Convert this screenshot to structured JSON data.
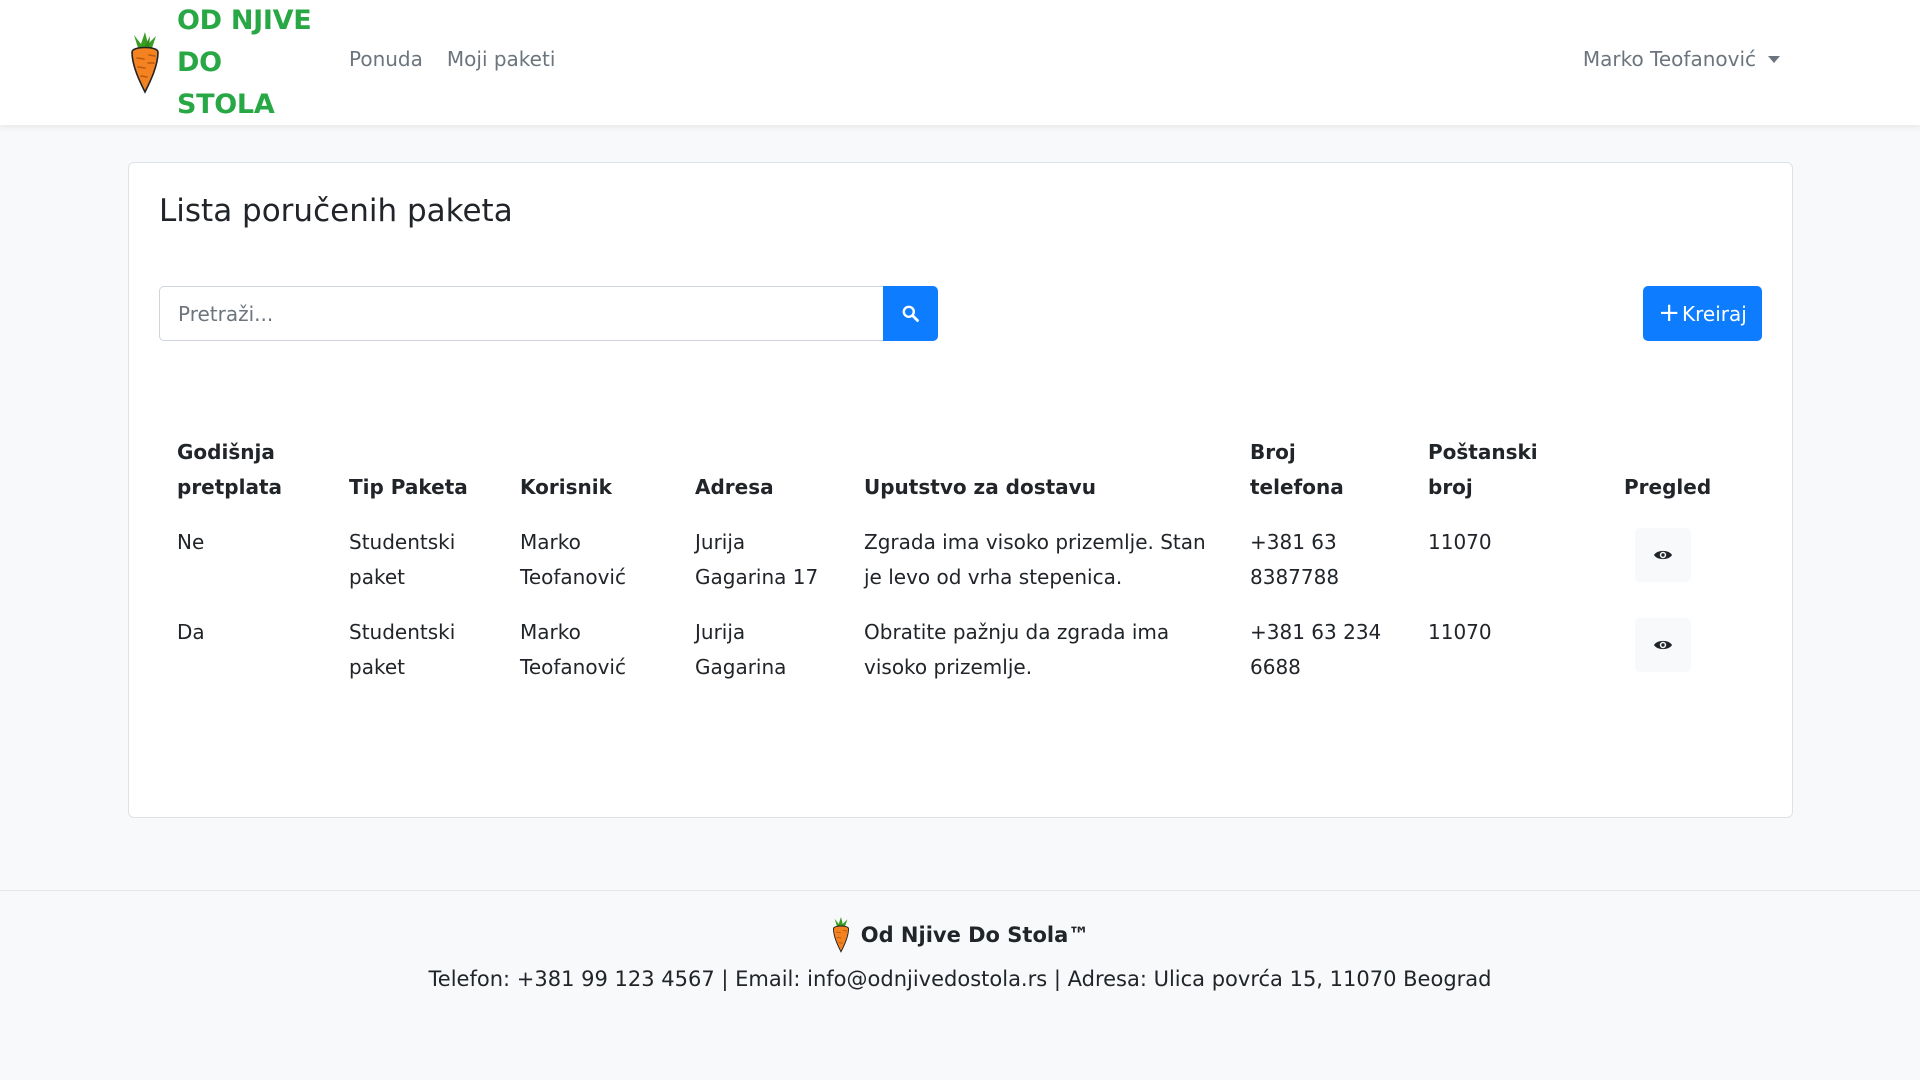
{
  "brand": {
    "line1": "OD NJIVE",
    "line2": "DO STOLA",
    "color": "#28a745",
    "logo_icon": "carrot-icon"
  },
  "nav": {
    "items": [
      {
        "label": "Ponuda"
      },
      {
        "label": "Moji paketi"
      }
    ]
  },
  "user_menu": {
    "name": "Marko Teofanović"
  },
  "main": {
    "title": "Lista poručenih paketa",
    "search": {
      "placeholder": "Pretraži...",
      "value": "",
      "button_icon": "search-icon"
    },
    "create_button": {
      "icon": "+",
      "label": "Kreiraj",
      "color": "#0d7cff"
    },
    "table": {
      "columns": [
        "Godišnja pretplata",
        "Tip Paketa",
        "Korisnik",
        "Adresa",
        "Uputstvo za dostavu",
        "Broj telefona",
        "Poštanski broj",
        "Pregled"
      ],
      "rows": [
        {
          "pretplata": "Ne",
          "tip": "Studentski paket",
          "korisnik": "Marko Teofanović",
          "adresa": "Jurija Gagarina 17",
          "uputstvo": "Zgrada ima visoko prizemlje. Stan je levo od vrha stepenica.",
          "telefon": "+381 63 8387788",
          "postanski": "11070",
          "view_icon": "eye-icon"
        },
        {
          "pretplata": "Da",
          "tip": "Studentski paket",
          "korisnik": "Marko Teofanović",
          "adresa": "Jurija Gagarina",
          "uputstvo": "Obratite pažnju da zgrada ima visoko prizemlje.",
          "telefon": "+381 63 234 6688",
          "postanski": "11070",
          "view_icon": "eye-icon"
        }
      ]
    }
  },
  "footer": {
    "brand": "Od Njive Do Stola™",
    "contact": "Telefon: +381 99 123 4567 | Email: info@odnjivedostola.rs | Adresa: Ulica povrća 15, 11070 Beograd"
  }
}
